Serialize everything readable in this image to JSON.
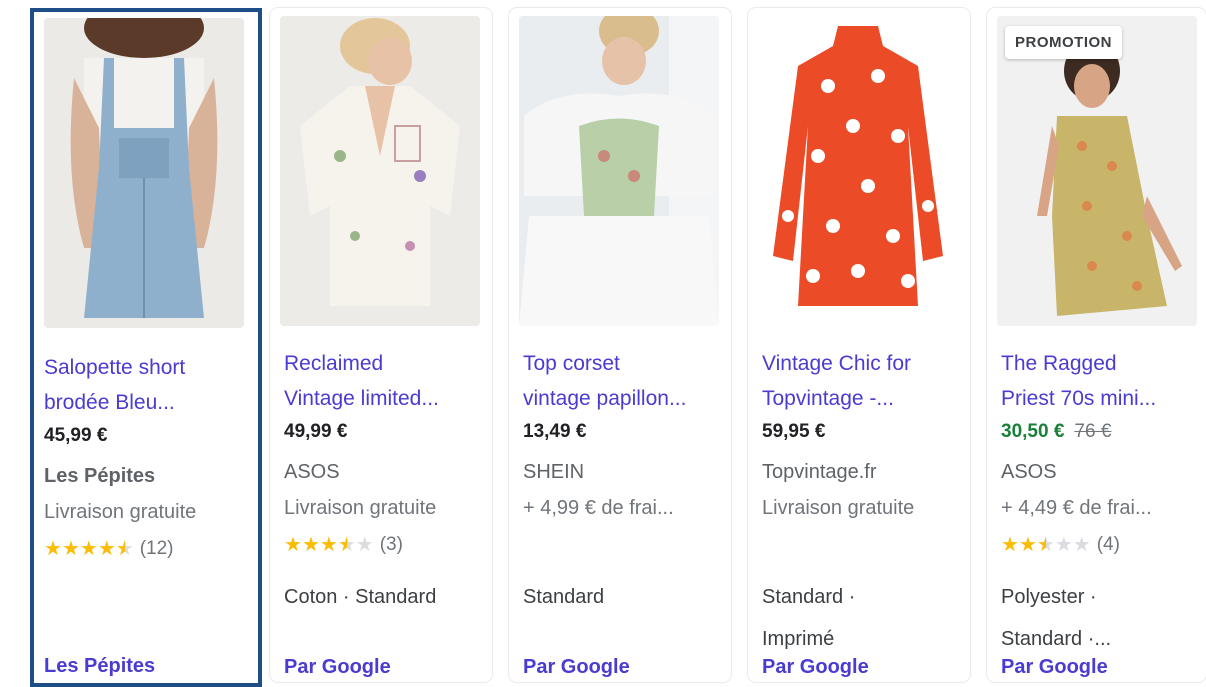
{
  "products": [
    {
      "title_line1": "Salopette short",
      "title_line2": "brodée Bleu...",
      "price": "45,99 €",
      "merchant": "Les Pépites",
      "shipping": "Livraison gratuite",
      "rating_count": "(12)",
      "attr_line1": "",
      "attr_line2": "",
      "footer": "Les Pépites",
      "image_icon": "denim-overalls-photo"
    },
    {
      "title_line1": "Reclaimed",
      "title_line2": "Vintage limited...",
      "price": "49,99 €",
      "merchant": "ASOS",
      "shipping": "Livraison gratuite",
      "rating_count": "(3)",
      "attr_line1": "Coton · Standard",
      "attr_line2": "",
      "footer": "Par Google",
      "image_icon": "embroidered-shirt-photo"
    },
    {
      "title_line1": "Top corset",
      "title_line2": "vintage papillon...",
      "price": "13,49 €",
      "merchant": "SHEIN",
      "shipping": "+ 4,99 € de frai...",
      "rating_count": "",
      "attr_line1": "Standard",
      "attr_line2": "",
      "footer": "Par Google",
      "image_icon": "floral-corset-photo"
    },
    {
      "title_line1": "Vintage Chic for",
      "title_line2": "Topvintage -...",
      "price": "59,95 €",
      "merchant": "Topvintage.fr",
      "shipping": "Livraison gratuite",
      "rating_count": "",
      "attr_line1": "Standard ·",
      "attr_line2": "Imprimé",
      "footer": "Par Google",
      "image_icon": "red-floral-dress-photo"
    },
    {
      "badge": "PROMOTION",
      "title_line1": "The Ragged",
      "title_line2": "Priest 70s mini...",
      "price": "30,50 €",
      "old_price": "76 €",
      "merchant": "ASOS",
      "shipping": "+ 4,49 € de frai...",
      "rating_count": "(4)",
      "attr_line1": "Polyester ·",
      "attr_line2": "Standard ·...",
      "footer": "Par Google",
      "image_icon": "floral-mini-dress-photo"
    }
  ],
  "colors": {
    "link": "#4a3bd1",
    "sale": "#188038",
    "star": "#fbbc04",
    "selected_border": "#1d4f86"
  },
  "ratings": [
    4.5,
    3.5,
    null,
    null,
    2.5
  ]
}
